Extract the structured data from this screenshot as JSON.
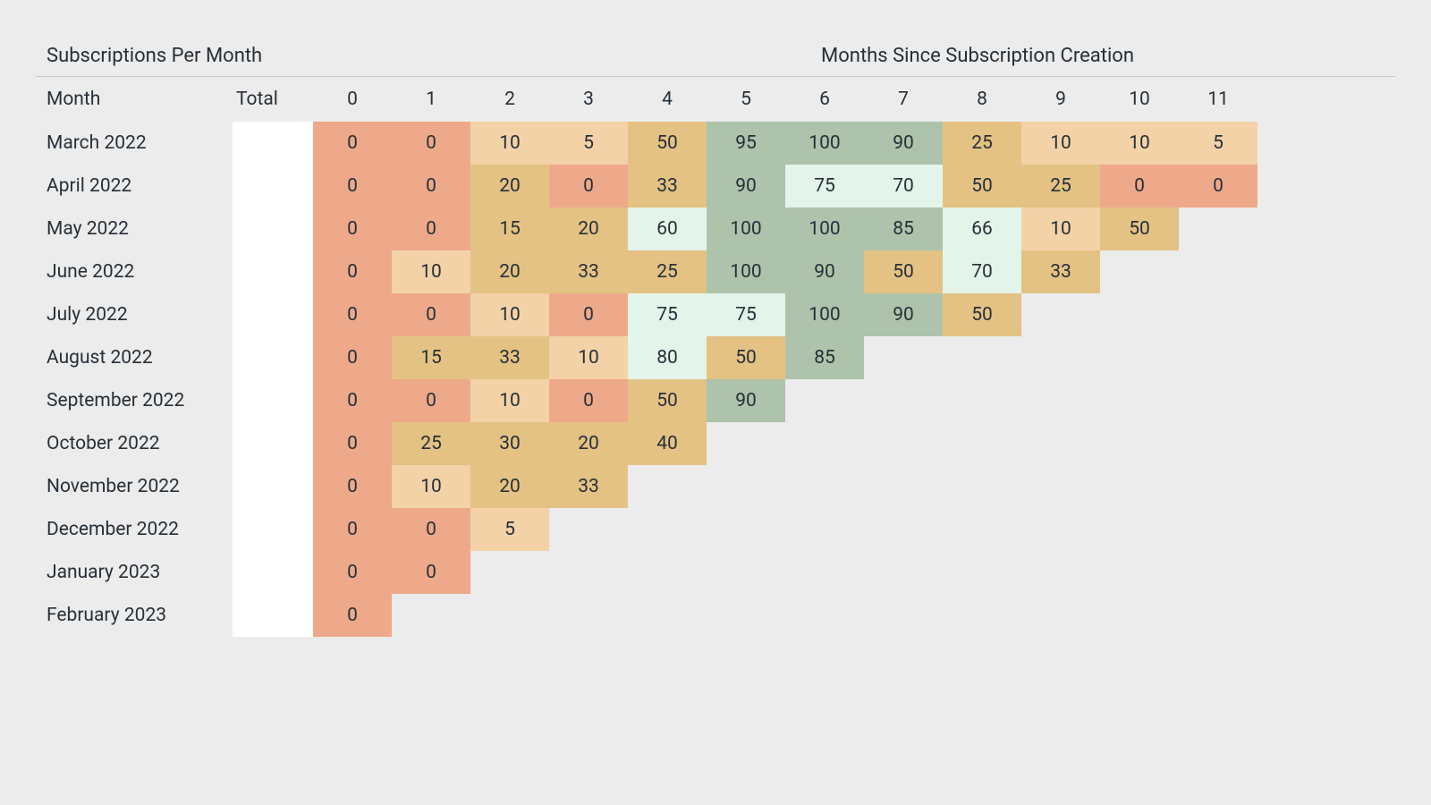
{
  "titles": {
    "left": "Subscriptions Per Month",
    "right": "Months Since Subscription Creation"
  },
  "columns": {
    "month": "Month",
    "total": "Total",
    "periods": [
      "0",
      "1",
      "2",
      "3",
      "4",
      "5",
      "6",
      "7",
      "8",
      "9",
      "10",
      "11"
    ]
  },
  "palette": {
    "comment": "5-step diverging: low→high = coral, peach, sand, mint, sage",
    "stops": [
      {
        "max": 0,
        "color": "#EEA98A"
      },
      {
        "max": 14,
        "color": "#F3D2A8"
      },
      {
        "max": 59,
        "color": "#E4C284"
      },
      {
        "max": 84,
        "color": "#E3F4EA"
      },
      {
        "max": 100,
        "color": "#AEC3AB"
      }
    ]
  },
  "chart_data": {
    "type": "heatmap",
    "xlabel": "Months Since Subscription Creation",
    "ylabel": "Month",
    "x": [
      "0",
      "1",
      "2",
      "3",
      "4",
      "5",
      "6",
      "7",
      "8",
      "9",
      "10",
      "11"
    ],
    "y": [
      "March 2022",
      "April 2022",
      "May 2022",
      "June 2022",
      "July 2022",
      "August 2022",
      "September 2022",
      "October 2022",
      "November 2022",
      "December 2022",
      "January 2023",
      "February 2023"
    ],
    "values": [
      [
        0,
        0,
        10,
        5,
        50,
        95,
        100,
        90,
        25,
        10,
        10,
        5
      ],
      [
        0,
        0,
        20,
        0,
        33,
        90,
        75,
        70,
        50,
        25,
        0,
        0
      ],
      [
        0,
        0,
        15,
        20,
        60,
        100,
        100,
        85,
        66,
        10,
        50
      ],
      [
        0,
        10,
        20,
        33,
        25,
        100,
        90,
        50,
        70,
        33
      ],
      [
        0,
        0,
        10,
        0,
        75,
        75,
        100,
        90,
        50
      ],
      [
        0,
        15,
        33,
        10,
        80,
        50,
        85
      ],
      [
        0,
        0,
        10,
        0,
        50,
        90
      ],
      [
        0,
        25,
        30,
        20,
        40
      ],
      [
        0,
        10,
        20,
        33
      ],
      [
        0,
        0,
        5
      ],
      [
        0,
        0
      ],
      [
        0
      ]
    ],
    "value_range": [
      0,
      100
    ]
  }
}
